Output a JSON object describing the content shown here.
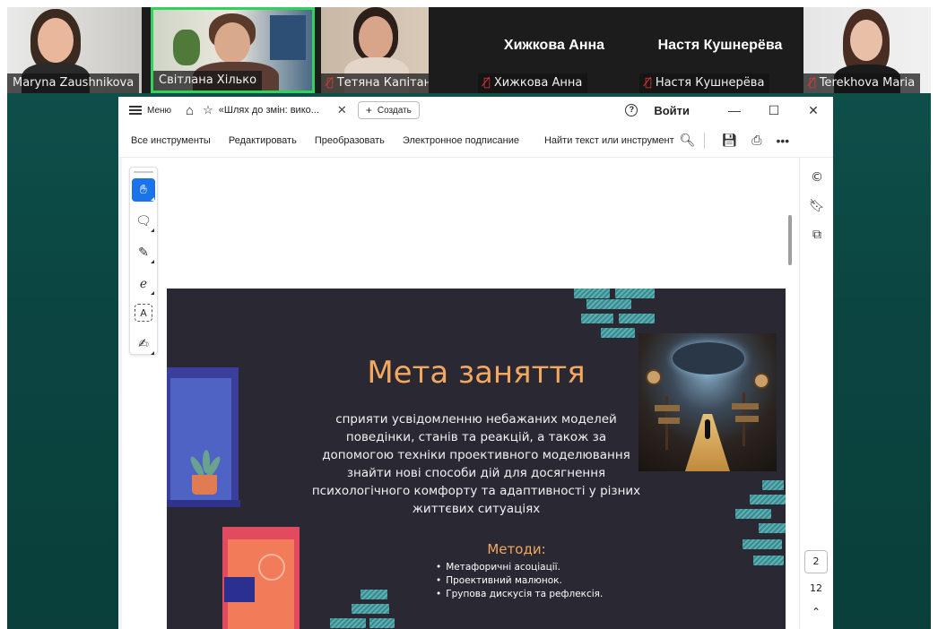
{
  "participants": [
    {
      "name": "Maryna Zaushnikova",
      "muted": false,
      "active": false
    },
    {
      "name": "Світлана Хілько",
      "muted": false,
      "active": true
    },
    {
      "name": "Тетяна Капітан",
      "muted": true,
      "active": false
    },
    {
      "name": "Хижкова Анна",
      "muted": true,
      "active": false,
      "big_name": "Хижкова Анна"
    },
    {
      "name": "Настя Кушнерёва",
      "muted": true,
      "active": false,
      "big_name": "Настя Кушнерёва"
    },
    {
      "name": "Terekhova Maria",
      "muted": true,
      "active": false
    }
  ],
  "app": {
    "menu_label": "Меню",
    "tab_title": "«Шлях до змін: вико...",
    "create_label": "Создать",
    "login_label": "Войти",
    "win_minimize": "—",
    "win_maximize": "☐",
    "win_close": "✕"
  },
  "toolbar": {
    "all_tools": "Все инструменты",
    "edit": "Редактировать",
    "convert": "Преобразовать",
    "esign": "Электронное подписание",
    "find": "Найти текст или инструмент"
  },
  "pager": {
    "current": "2",
    "total": "12"
  },
  "slide": {
    "title": "Мета заняття",
    "body": "сприяти усвідомленню небажаних моделей поведінки, станів та реакцій, а також за допомогою техніки проективного моделювання знайти нові способи дій для досягнення психологічного комфорту та адаптивності у різних життєвих ситуаціях",
    "methods_title": "Методи:",
    "methods": [
      "Метафоричні асоціації.",
      "Проективний малюнок.",
      "Групова дискусія та рефлексія."
    ]
  },
  "icons": {
    "hand_tool": "hand-icon",
    "comment_tool": "comment-icon",
    "pen_tool": "pen-icon",
    "lasso_tool": "lasso-icon",
    "text_select_tool": "text-box-icon",
    "stamp_tool": "stamp-icon"
  },
  "colors": {
    "accent": "#1a73e8",
    "slide_bg": "#2a2833",
    "slide_title": "#f4a85f",
    "active_speaker": "#2fd35a",
    "mute": "#e53935"
  }
}
